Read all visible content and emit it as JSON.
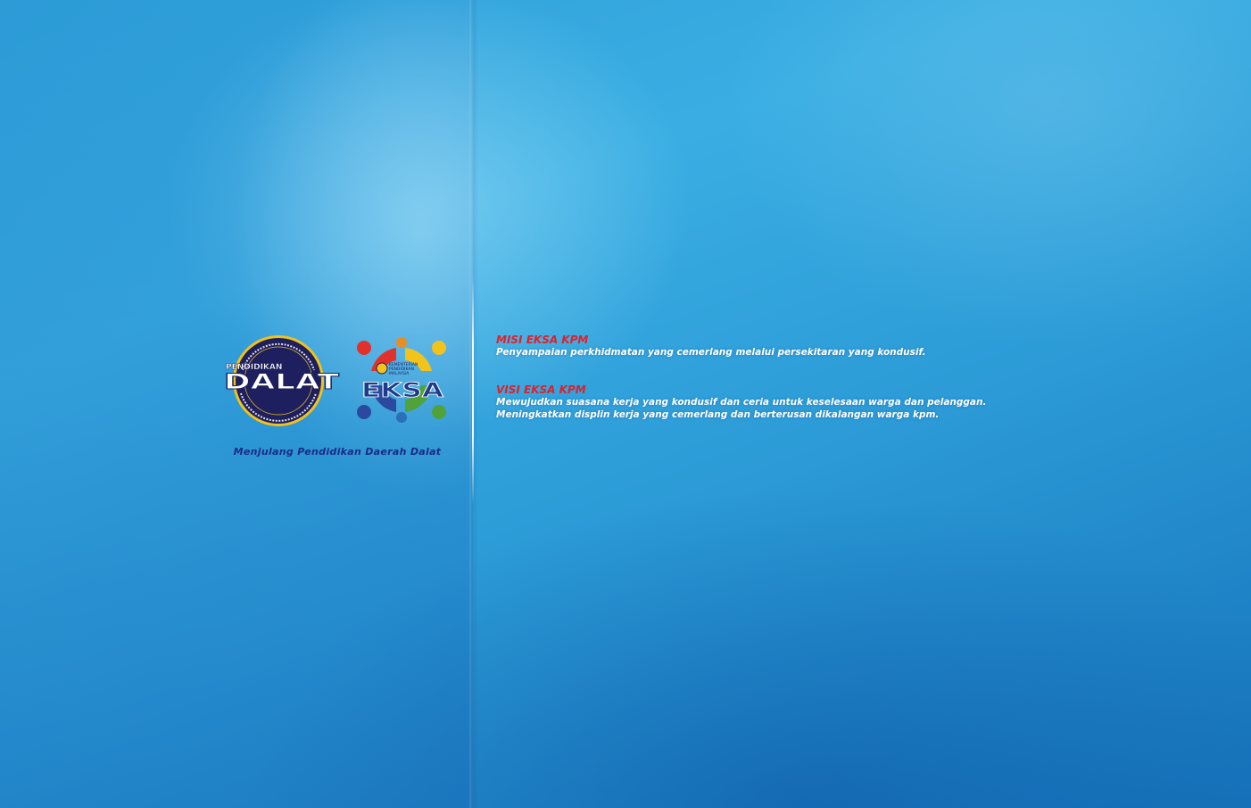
{
  "logos": {
    "dalat": {
      "line1": "PENDIDIKAN",
      "line2": "DALAT"
    },
    "eksa": {
      "text": "EKSA",
      "ministry_lines": [
        "KEMENTERIAN",
        "PENDIDIKAN",
        "MALAYSIA"
      ]
    }
  },
  "tagline": "Menjulang Pendidikan Daerah Dalat",
  "misi": {
    "heading": "MISI EKSA KPM",
    "lines": [
      "Penyampaian perkhidmatan yang cemerlang melalui persekitaran yang kondusif."
    ]
  },
  "visi": {
    "heading": "VISI EKSA KPM",
    "lines": [
      "Mewujudkan suasana kerja yang kondusif dan ceria untuk keselesaan warga dan pelanggan.",
      "Meningkatkan displin kerja yang cemerlang dan berterusan dikalangan warga kpm."
    ]
  },
  "colors": {
    "heading_red": "#e0202a",
    "tagline_navy": "#1a2b86",
    "background_blue": "#2b9ad6"
  }
}
